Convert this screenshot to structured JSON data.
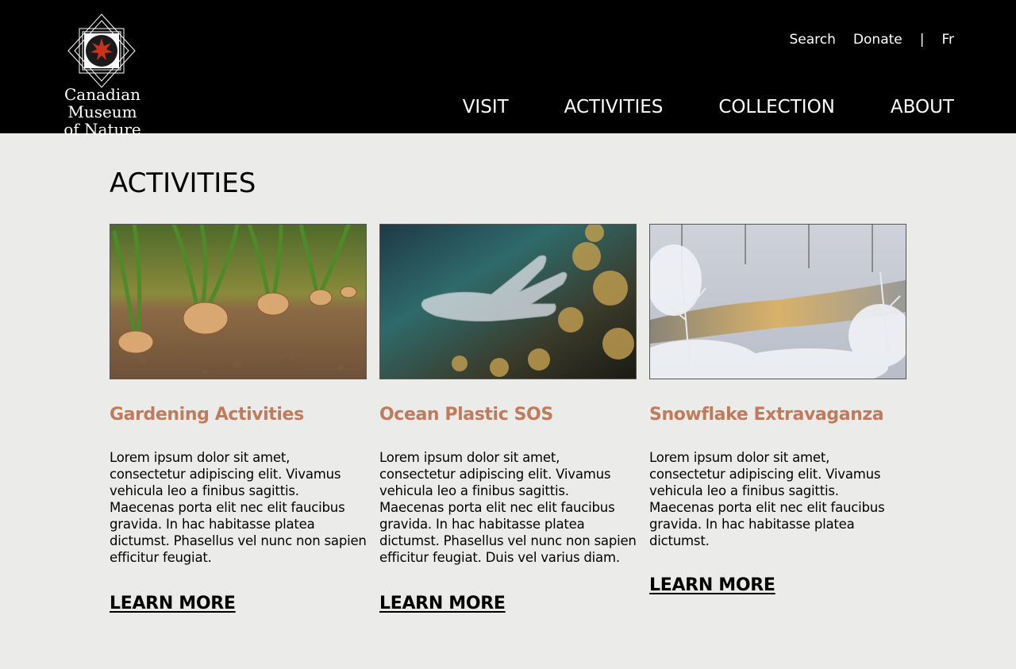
{
  "header": {
    "logo_text_line1": "Canadian Museum",
    "logo_text_line2": "of Nature",
    "utility_links": {
      "search": "Search",
      "donate": "Donate",
      "separator": "|",
      "language": "Fr"
    },
    "nav": {
      "visit": "VISIT",
      "activities": "ACTIVITIES",
      "collection": "COLLECTION",
      "about": "ABOUT"
    }
  },
  "main": {
    "title": "ACTIVITIES",
    "cards": [
      {
        "title": "Gardening Activities",
        "body": "Lorem ipsum dolor sit amet, consectetur adipiscing elit. Vivamus vehicula leo a finibus sagittis. Maecenas porta elit nec elit faucibus gravida. In hac habitasse platea dictumst. Phasellus vel nunc non sapien efficitur feugiat.",
        "link": "LEARN MORE"
      },
      {
        "title": "Ocean Plastic SOS",
        "body": "Lorem ipsum dolor sit amet, consectetur adipiscing elit. Vivamus vehicula leo a finibus sagittis. Maecenas porta elit nec elit faucibus gravida. In hac habitasse platea dictumst. Phasellus vel nunc non sapien efficitur feugiat. Duis vel varius diam.",
        "link": "LEARN MORE"
      },
      {
        "title": "Snowflake Extravaganza",
        "body": "Lorem ipsum dolor sit amet, consectetur adipiscing elit. Vivamus vehicula leo a finibus sagittis. Maecenas porta elit nec elit faucibus gravida. In hac habitasse platea dictumst.",
        "link": "LEARN MORE"
      }
    ]
  },
  "colors": {
    "header_bg": "#000000",
    "page_bg": "#ebebe9",
    "card_title": "#c07a5c"
  }
}
